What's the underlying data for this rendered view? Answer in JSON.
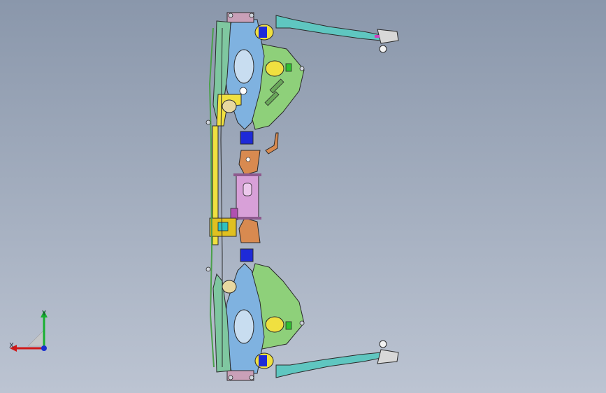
{
  "viewport": {
    "background_top": "#8a97ab",
    "background_bottom": "#bcc4d2"
  },
  "triad": {
    "x_label": "X",
    "y_label": "Y",
    "x_color": "#d01818",
    "y_color": "#18b030",
    "z_color": "#1a2fd0"
  },
  "model": {
    "colors": {
      "subframe_green": "#8ed07a",
      "arm_teal": "#5fc6c0",
      "knuckle_blue": "#7fb2e0",
      "crossmember_pink": "#d8a0d8",
      "stabilizer_yellow": "#f0e040",
      "bushing_blue": "#1e2ad8",
      "bracket_orange": "#d88a50",
      "outline": "#2a2a2a"
    }
  }
}
